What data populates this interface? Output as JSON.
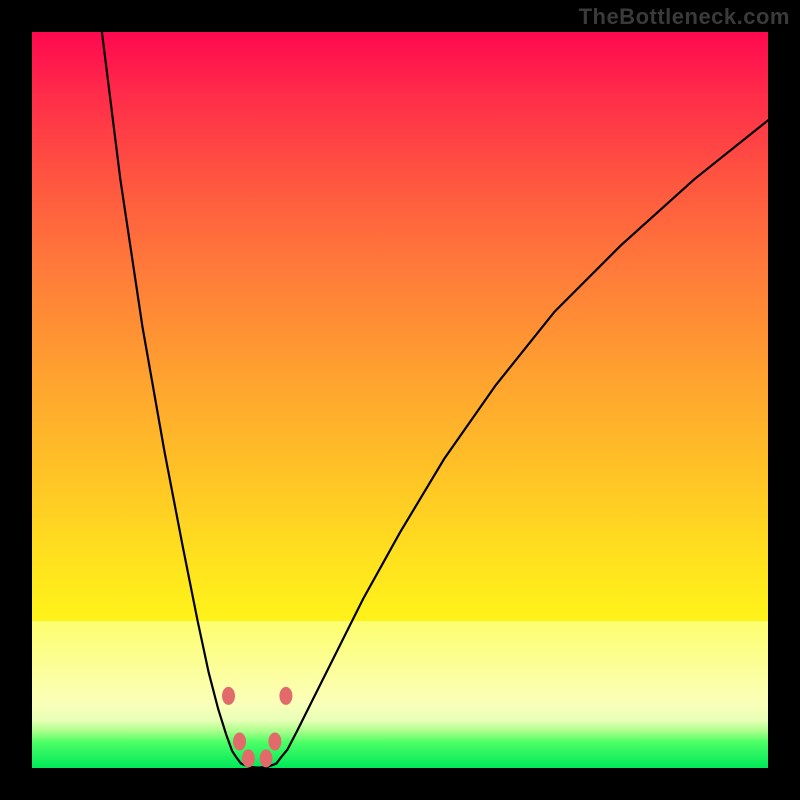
{
  "watermark": "TheBottleneck.com",
  "chart_data": {
    "type": "line",
    "title": "",
    "xlabel": "",
    "ylabel": "",
    "xlim": [
      0,
      100
    ],
    "ylim": [
      0,
      100
    ],
    "series": [
      {
        "name": "left-branch",
        "x": [
          9.5,
          12,
          15,
          18,
          20.5,
          22.5,
          24,
          25.3,
          26.4,
          27.2,
          27.8,
          28.4
        ],
        "values": [
          100,
          80,
          60,
          43,
          30,
          20,
          13,
          8,
          4.5,
          2.3,
          1.4,
          0.6
        ]
      },
      {
        "name": "right-branch",
        "x": [
          33.2,
          33.8,
          34.7,
          36,
          38,
          41,
          45,
          50,
          56,
          63,
          71,
          80,
          90,
          100
        ],
        "values": [
          0.6,
          1.4,
          2.5,
          5,
          9,
          15,
          23,
          32,
          42,
          52,
          62,
          71,
          80,
          88
        ]
      }
    ],
    "floor": {
      "name": "valley-floor",
      "x": [
        28.4,
        29.5,
        30.8,
        32.0,
        33.2
      ],
      "values": [
        0.6,
        0.15,
        0.05,
        0.15,
        0.6
      ]
    },
    "markers": [
      {
        "x": 26.7,
        "y": 9.8
      },
      {
        "x": 34.5,
        "y": 9.8
      },
      {
        "x": 28.2,
        "y": 3.6
      },
      {
        "x": 33.0,
        "y": 3.6
      },
      {
        "x": 29.4,
        "y": 1.3
      },
      {
        "x": 31.8,
        "y": 1.3
      }
    ],
    "gradient_bands": [
      {
        "zone": "red-orange-yellow",
        "from_y": 100,
        "to_y": 20
      },
      {
        "zone": "pale-yellow",
        "from_y": 20,
        "to_y": 6.5
      },
      {
        "zone": "green",
        "from_y": 6.5,
        "to_y": 0
      }
    ],
    "colors": {
      "top": "#ff084f",
      "mid": "#ffc326",
      "band": "#fbffb8",
      "bottom": "#00e85a",
      "curve": "#000000",
      "marker": "#e26a6a"
    }
  }
}
